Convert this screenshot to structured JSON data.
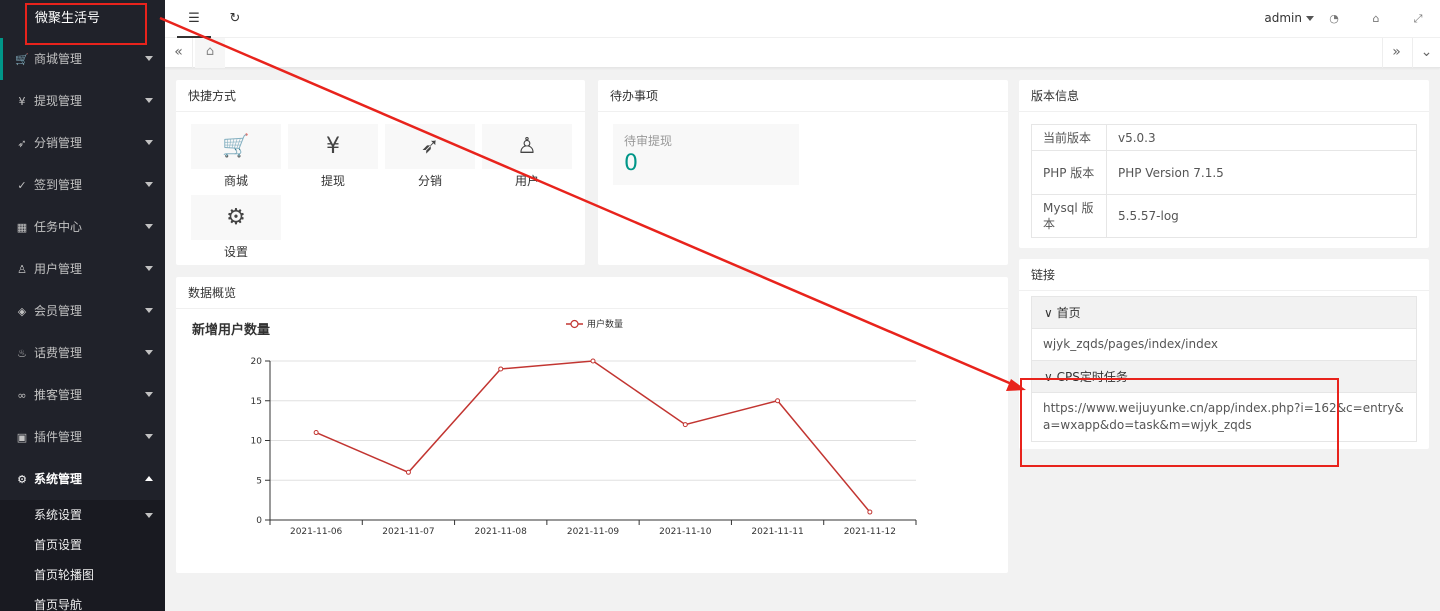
{
  "sidebar": {
    "brand": "微聚生活号",
    "items": [
      {
        "label": "商城管理",
        "icon": "cart-icon",
        "glyph": "🛒"
      },
      {
        "label": "提现管理",
        "icon": "yen-circle-icon",
        "glyph": "¥"
      },
      {
        "label": "分销管理",
        "icon": "send-icon",
        "glyph": "➶"
      },
      {
        "label": "签到管理",
        "icon": "check-icon",
        "glyph": "✓"
      },
      {
        "label": "任务中心",
        "icon": "tasks-icon",
        "glyph": "▦"
      },
      {
        "label": "用户管理",
        "icon": "user-icon",
        "glyph": "♙"
      },
      {
        "label": "会员管理",
        "icon": "diamond-icon",
        "glyph": "◈"
      },
      {
        "label": "话费管理",
        "icon": "fire-icon",
        "glyph": "♨"
      },
      {
        "label": "推客管理",
        "icon": "link-icon",
        "glyph": "∞"
      },
      {
        "label": "插件管理",
        "icon": "cube-icon",
        "glyph": "▣"
      },
      {
        "label": "系统管理",
        "icon": "gear-icon",
        "glyph": "⚙"
      }
    ],
    "subitems": [
      "系统设置",
      "首页设置",
      "首页轮播图",
      "首页导航"
    ]
  },
  "header": {
    "user": "admin"
  },
  "shortcuts": {
    "title": "快捷方式",
    "items": [
      {
        "label": "商城",
        "icon": "cart-icon",
        "glyph": "🛒"
      },
      {
        "label": "提现",
        "icon": "yen-circle-icon",
        "glyph": "¥"
      },
      {
        "label": "分销",
        "icon": "paper-plane-icon",
        "glyph": "➶"
      },
      {
        "label": "用户",
        "icon": "user-icon",
        "glyph": "♙"
      },
      {
        "label": "设置",
        "icon": "gear-icon",
        "glyph": "⚙"
      }
    ]
  },
  "todo": {
    "title": "待办事项",
    "label": "待审提现",
    "count": "0"
  },
  "version": {
    "title": "版本信息",
    "rows": [
      {
        "key": "当前版本",
        "value": "v5.0.3"
      },
      {
        "key": "PHP 版本",
        "value": "PHP Version 7.1.5"
      },
      {
        "key": "Mysql 版本",
        "value": "5.5.57-log"
      }
    ]
  },
  "links": {
    "title": "链接",
    "sections": [
      {
        "header": "首页",
        "body": "wjyk_zqds/pages/index/index"
      },
      {
        "header": "CPS定时任务",
        "body": "https://www.weijuyunke.cn/app/index.php?i=162&c=entry&a=wxapp&do=task&m=wjyk_zqds"
      }
    ]
  },
  "overview": {
    "title": "数据概览"
  },
  "chart_data": {
    "type": "line",
    "title": "新增用户数量",
    "categories": [
      "2021-11-06",
      "2021-11-07",
      "2021-11-08",
      "2021-11-09",
      "2021-11-10",
      "2021-11-11",
      "2021-11-12"
    ],
    "series": [
      {
        "name": "用户数量",
        "values": [
          11,
          6,
          19,
          20,
          12,
          15,
          1
        ],
        "color": "#c23531"
      }
    ],
    "yticks": [
      0,
      5,
      10,
      15,
      20
    ],
    "ylim": [
      0,
      20
    ],
    "grid": true,
    "legend": "top-center"
  },
  "colors": {
    "accent": "#009688",
    "sidebar": "#20222a",
    "annotation": "#e8231c"
  }
}
